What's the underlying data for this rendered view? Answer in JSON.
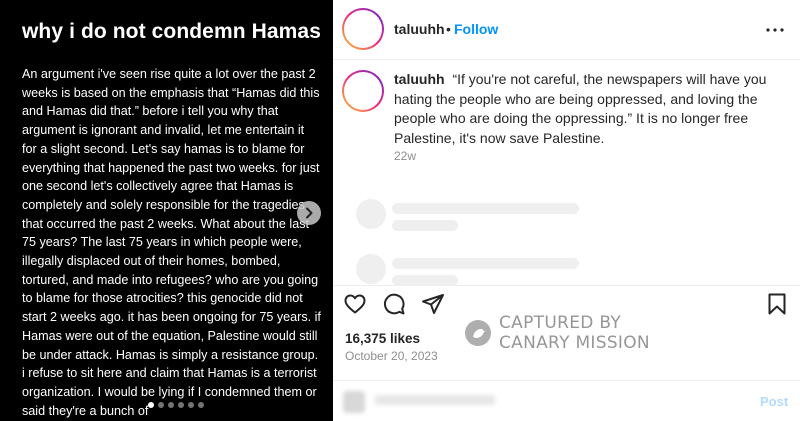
{
  "media": {
    "title": "why i do not condemn Hamas",
    "body": "An argument i've seen rise quite a lot over the past 2 weeks is based on the emphasis that “Hamas did this and Hamas did that.” before i tell you why that argument is ignorant and invalid, let me entertain it for a slight second. Let's say hamas is to blame for everything that happened the past two weeks. for just one second let's collectively agree that Hamas is completely and solely responsible for the tragedies that occurred the past 2 weeks. What about the last 75 years? The last 75 years in which people were, illegally displaced out of their homes, bombed, tortured, and made into refugees? who are you going to blame for those atrocities? this genocide did not start 2 weeks ago. it has been ongoing for 75 years. if Hamas were out of the equation, Palestine would still be under attack. Hamas is simply a resistance group. i refuse to sit here and claim that Hamas is a terrorist organization. I would be lying if I condemned them or said they're a bunch of",
    "slide_count": 6,
    "active_slide": 1
  },
  "post": {
    "username": "taluuhh",
    "follow_label": "Follow",
    "separator": "•",
    "caption": "“If you're not careful, the newspapers will have you hating the people who are being oppressed, and loving the people who are doing the oppressing.” It is no longer free Palestine, it's now save Palestine.",
    "time_ago": "22w",
    "likes": "16,375 likes",
    "date": "October 20, 2023"
  },
  "icons": {
    "more": "more-icon",
    "like": "heart-icon",
    "comment": "comment-icon",
    "share": "share-icon",
    "save": "bookmark-icon",
    "next": "chevron-right-icon"
  },
  "watermark": {
    "line1": "CAPTURED BY",
    "line2": "CANARY MISSION"
  },
  "comment": {
    "post_label": "Post"
  },
  "colors": {
    "link": "#0095f6",
    "post_disabled": "#b3dbff",
    "muted": "#8e8e8e"
  }
}
